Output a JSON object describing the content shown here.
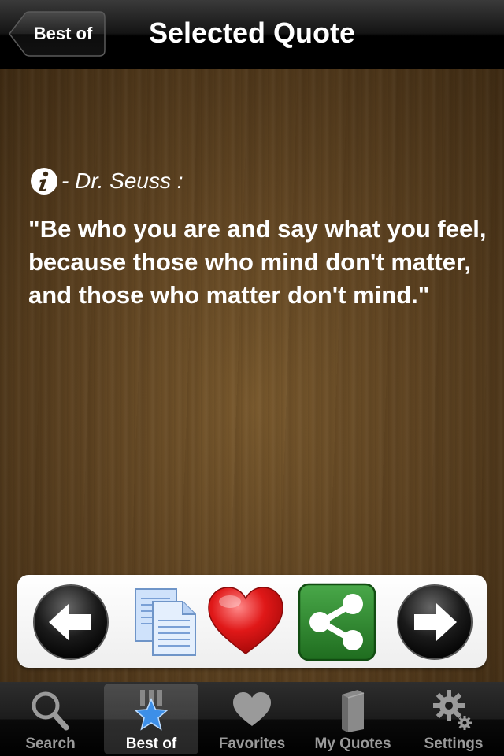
{
  "nav": {
    "back_label": "Best of",
    "title": "Selected Quote"
  },
  "quote": {
    "author": "- Dr. Seuss :",
    "text": "\"Be who you are and say what you feel, because those who mind don't matter, and those who matter don't mind.\""
  },
  "actions": [
    {
      "name": "previous-button",
      "icon": "arrow-left-icon"
    },
    {
      "name": "copy-button",
      "icon": "copy-icon"
    },
    {
      "name": "favorite-button",
      "icon": "heart-icon"
    },
    {
      "name": "share-button",
      "icon": "share-icon"
    },
    {
      "name": "next-button",
      "icon": "arrow-right-icon"
    }
  ],
  "tabs": [
    {
      "label": "Search",
      "icon": "magnifier-icon",
      "selected": false
    },
    {
      "label": "Best of",
      "icon": "star-medal-icon",
      "selected": true
    },
    {
      "label": "Favorites",
      "icon": "heart-icon",
      "selected": false
    },
    {
      "label": "My Quotes",
      "icon": "book-icon",
      "selected": false
    },
    {
      "label": "Settings",
      "icon": "gears-icon",
      "selected": false
    }
  ],
  "colors": {
    "heart": "#e01818",
    "share": "#2f8a2f",
    "selected_tab_star": "#3d8fe8"
  }
}
